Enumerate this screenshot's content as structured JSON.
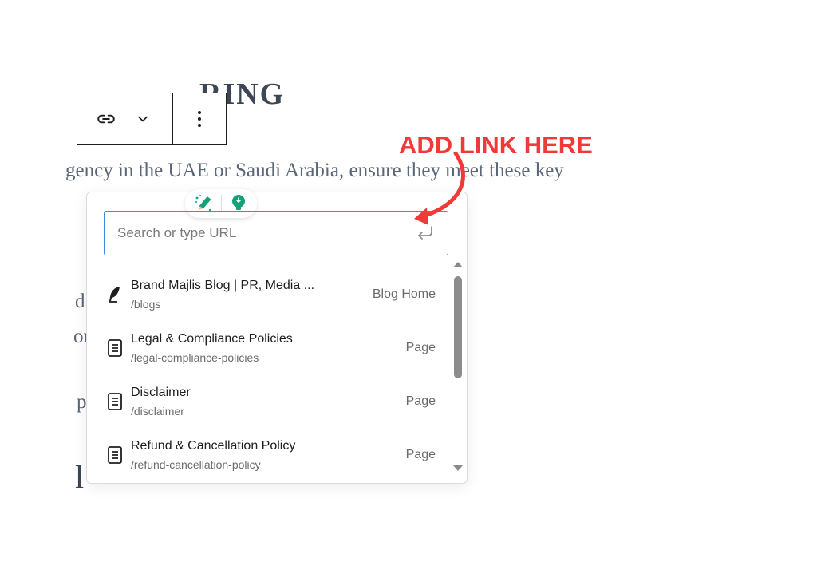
{
  "background": {
    "heading_visible": "RING",
    "paragraph_visible": "gency in the UAE or Saudi Arabia, ensure they meet these key",
    "fragments": [
      "d",
      "or",
      "p",
      "l"
    ]
  },
  "annotation": {
    "text": "ADD LINK HERE",
    "color": "#f03a3a"
  },
  "toolbar": {
    "icons": [
      "link-icon",
      "chevron-down-icon",
      "more-vertical-icon"
    ]
  },
  "link_popover": {
    "search": {
      "placeholder": "Search or type URL",
      "value": ""
    },
    "results": [
      {
        "title": "Brand Majlis Blog | PR, Media ...",
        "url": "/blogs",
        "type": "Blog Home",
        "icon": "feather-icon"
      },
      {
        "title": "Legal & Compliance Policies",
        "url": "/legal-compliance-policies",
        "type": "Page",
        "icon": "page-icon"
      },
      {
        "title": "Disclaimer",
        "url": "/disclaimer",
        "type": "Page",
        "icon": "page-icon"
      },
      {
        "title": "Refund & Cancellation Policy",
        "url": "/refund-cancellation-policy",
        "type": "Page",
        "icon": "page-icon"
      }
    ]
  },
  "colors": {
    "accent": "#3b8ee0",
    "ai_icon": "#12a17a"
  }
}
